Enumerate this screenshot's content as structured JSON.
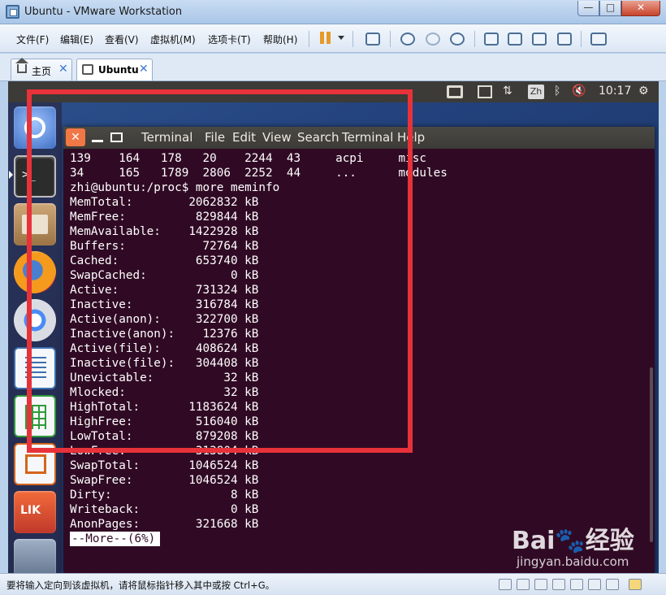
{
  "window": {
    "title": "Ubuntu - VMware Workstation",
    "minimize": "—",
    "maximize": "□",
    "close": "✕"
  },
  "menubar": {
    "items": [
      "文件(F)",
      "编辑(E)",
      "查看(V)",
      "虚拟机(M)",
      "选项卡(T)",
      "帮助(H)"
    ]
  },
  "tabs": [
    {
      "label": "主页",
      "close": "✕"
    },
    {
      "label": "Ubuntu",
      "close": "✕"
    }
  ],
  "ubuntu_topbar": {
    "ime": "Zh",
    "time": "10:17"
  },
  "launcher": {
    "software_center_text": "LIK"
  },
  "terminal": {
    "menu": [
      "Terminal",
      "File",
      "Edit",
      "View",
      "Search",
      "Terminal",
      "Help"
    ],
    "close": "✕",
    "prompt_glyph": ">_",
    "lines": [
      "139    164   178   20    2244  43     acpi     misc",
      "34     165   1789  2806  2252  44     ...      modules",
      "zhi@ubuntu:/proc$ more meminfo",
      "MemTotal:        2062832 kB",
      "MemFree:          829844 kB",
      "MemAvailable:    1422928 kB",
      "Buffers:           72764 kB",
      "Cached:           653740 kB",
      "SwapCached:            0 kB",
      "Active:           731324 kB",
      "Inactive:         316784 kB",
      "Active(anon):     322700 kB",
      "Inactive(anon):    12376 kB",
      "Active(file):     408624 kB",
      "Inactive(file):   304408 kB",
      "Unevictable:          32 kB",
      "Mlocked:              32 kB",
      "HighTotal:       1183624 kB",
      "HighFree:         516040 kB",
      "LowTotal:         879208 kB",
      "LowFree:          313804 kB",
      "SwapTotal:       1046524 kB",
      "SwapFree:        1046524 kB",
      "Dirty:                 8 kB",
      "Writeback:             0 kB",
      "AnonPages:        321668 kB"
    ],
    "more_prompt": "--More--(6%)"
  },
  "statusbar": {
    "text": "要将输入定向到该虚拟机，请将鼠标指针移入其中或按 Ctrl+G。"
  },
  "watermark": {
    "brand": "Bai🐾经验",
    "url": "jingyan.baidu.com"
  },
  "colors": {
    "terminal_bg": "#300a24",
    "highlight": "#e8323a",
    "ubuntu_orange": "#f07746"
  }
}
